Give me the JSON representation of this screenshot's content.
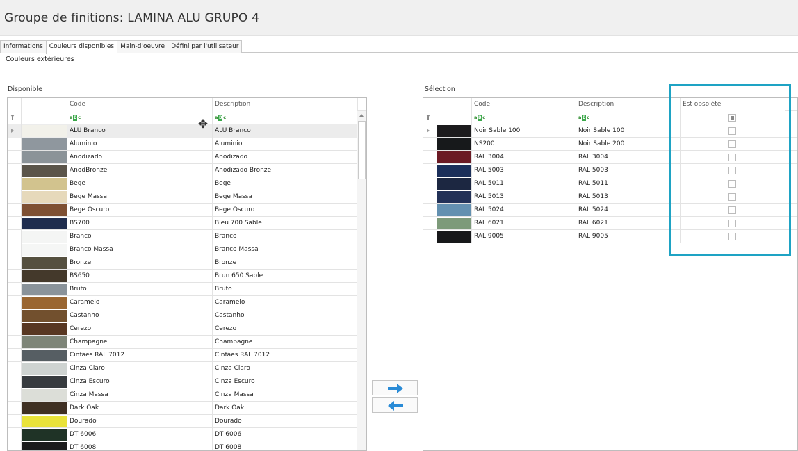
{
  "window": {
    "title": "Groupe de finitions: LAMINA ALU GRUPO 4"
  },
  "tabs": [
    {
      "label": "Informations",
      "active": false
    },
    {
      "label": "Couleurs disponibles",
      "active": true
    },
    {
      "label": "Main-d'oeuvre",
      "active": false
    },
    {
      "label": "Défini par l'utilisateur",
      "active": false
    }
  ],
  "section": {
    "title": "Couleurs extérieures"
  },
  "available": {
    "label": "Disponible",
    "columns": {
      "code": "Code",
      "description": "Description"
    },
    "filter_icon": "abc-filter-icon",
    "rows": [
      {
        "color": "#f2f1ea",
        "code": "ALU Branco",
        "description": "ALU Branco"
      },
      {
        "color": "#8f979e",
        "code": "Aluminio",
        "description": "Aluminio"
      },
      {
        "color": "#8b9398",
        "code": "Anodizado",
        "description": "Anodizado"
      },
      {
        "color": "#5b554a",
        "code": "AnodBronze",
        "description": "Anodizado Bronze"
      },
      {
        "color": "#d2c38e",
        "code": "Bege",
        "description": "Bege"
      },
      {
        "color": "#e6d9bb",
        "code": "Bege Massa",
        "description": "Bege Massa"
      },
      {
        "color": "#7e5033",
        "code": "Bege Oscuro",
        "description": "Bege Oscuro"
      },
      {
        "color": "#1f2d4e",
        "code": "BS700",
        "description": "Bleu 700 Sable"
      },
      {
        "color": "#f4f5f4",
        "code": "Branco",
        "description": "Branco"
      },
      {
        "color": "#f5f6f5",
        "code": "Branco Massa",
        "description": "Branco Massa"
      },
      {
        "color": "#55503f",
        "code": "Bronze",
        "description": "Bronze"
      },
      {
        "color": "#44392b",
        "code": "BS650",
        "description": "Brun 650 Sable"
      },
      {
        "color": "#8a939a",
        "code": "Bruto",
        "description": "Bruto"
      },
      {
        "color": "#9a6631",
        "code": "Caramelo",
        "description": "Caramelo"
      },
      {
        "color": "#72502e",
        "code": "Castanho",
        "description": "Castanho"
      },
      {
        "color": "#583722",
        "code": "Cerezo",
        "description": "Cerezo"
      },
      {
        "color": "#7e8578",
        "code": "Champagne",
        "description": "Champagne"
      },
      {
        "color": "#565e63",
        "code": "Cinfães RAL 7012",
        "description": "Cinfães RAL 7012"
      },
      {
        "color": "#ced3d1",
        "code": "Cinza Claro",
        "description": "Cinza Claro"
      },
      {
        "color": "#373b3f",
        "code": "Cinza Escuro",
        "description": "Cinza Escuro"
      },
      {
        "color": "#dcded8",
        "code": "Cinza Massa",
        "description": "Cinza Massa"
      },
      {
        "color": "#3f3023",
        "code": "Dark Oak",
        "description": "Dark Oak"
      },
      {
        "color": "#e9e33a",
        "code": "Dourado",
        "description": "Dourado"
      },
      {
        "color": "#1f3326",
        "code": "DT 6006",
        "description": "DT 6006"
      },
      {
        "color": "#1b1c1c",
        "code": "DT 6008",
        "description": "DT 6008"
      }
    ]
  },
  "selection": {
    "label": "Sélection",
    "columns": {
      "code": "Code",
      "description": "Description",
      "obsolete": "Est obsolète"
    },
    "rows": [
      {
        "color": "#1c1b1d",
        "code": "Noir Sable 100",
        "description": "Noir Sable 100",
        "obsolete": false
      },
      {
        "color": "#17191b",
        "code": "NS200",
        "description": "Noir Sable 200",
        "obsolete": false
      },
      {
        "color": "#6b1a24",
        "code": "RAL 3004",
        "description": "RAL 3004",
        "obsolete": false
      },
      {
        "color": "#1b2f5a",
        "code": "RAL 5003",
        "description": "RAL 5003",
        "obsolete": false
      },
      {
        "color": "#1c2741",
        "code": "RAL 5011",
        "description": "RAL 5011",
        "obsolete": false
      },
      {
        "color": "#223157",
        "code": "RAL 5013",
        "description": "RAL 5013",
        "obsolete": false
      },
      {
        "color": "#6390b0",
        "code": "RAL 5024",
        "description": "RAL 5024",
        "obsolete": false
      },
      {
        "color": "#7d9a7a",
        "code": "RAL 6021",
        "description": "RAL 6021",
        "obsolete": false
      },
      {
        "color": "#17181a",
        "code": "RAL 9005",
        "description": "RAL 9005",
        "obsolete": false
      }
    ]
  },
  "buttons": {
    "add_icon": "arrow-right-icon",
    "remove_icon": "arrow-left-icon",
    "accent": "#2a8bd6"
  },
  "highlight_color": "#1ea3c4"
}
